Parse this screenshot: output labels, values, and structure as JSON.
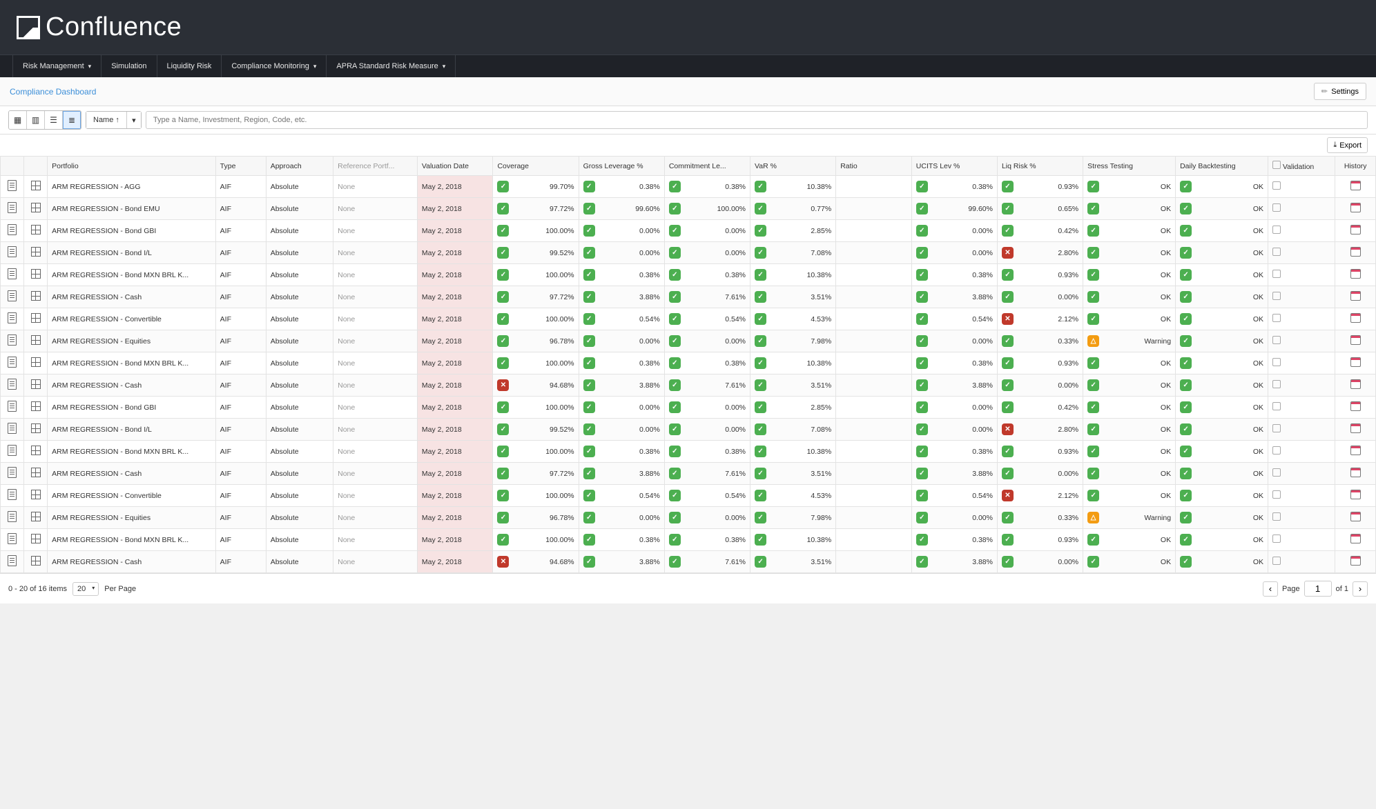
{
  "brand": "Confluence",
  "nav": [
    {
      "label": "Risk Management",
      "chevron": true
    },
    {
      "label": "Simulation",
      "chevron": false
    },
    {
      "label": "Liquidity Risk",
      "chevron": false
    },
    {
      "label": "Compliance Monitoring",
      "chevron": true
    },
    {
      "label": "APRA Standard Risk Measure",
      "chevron": true
    }
  ],
  "breadcrumb": "Compliance Dashboard",
  "settings_label": "Settings",
  "sort_label": "Name ↑",
  "search_placeholder": "Type a Name, Investment, Region, Code, etc.",
  "export_label": "Export",
  "columns": [
    "",
    "",
    "Portfolio",
    "Type",
    "Approach",
    "Reference Portf...",
    "Valuation Date",
    "Coverage",
    "Gross Leverage %",
    "Commitment Le...",
    "VaR %",
    "Ratio",
    "UCITS Lev %",
    "Liq Risk %",
    "Stress Testing",
    "Daily Backtesting",
    "Validation",
    "History"
  ],
  "rows": [
    {
      "portfolio": "ARM REGRESSION - AGG",
      "type": "AIF",
      "approach": "Absolute",
      "ref": "None",
      "date": "May 2, 2018",
      "coverage": {
        "s": "ok",
        "v": "99.70%"
      },
      "gross": {
        "s": "ok",
        "v": "0.38%"
      },
      "commit": {
        "s": "ok",
        "v": "0.38%"
      },
      "var": {
        "s": "ok",
        "v": "10.38%"
      },
      "ratio": "",
      "ucits": {
        "s": "ok",
        "v": "0.38%"
      },
      "liq": {
        "s": "ok",
        "v": "0.93%"
      },
      "stress": {
        "s": "ok",
        "v": "OK"
      },
      "back": {
        "s": "ok",
        "v": "OK"
      }
    },
    {
      "portfolio": "ARM REGRESSION - Bond EMU",
      "type": "AIF",
      "approach": "Absolute",
      "ref": "None",
      "date": "May 2, 2018",
      "coverage": {
        "s": "ok",
        "v": "97.72%"
      },
      "gross": {
        "s": "ok",
        "v": "99.60%"
      },
      "commit": {
        "s": "ok",
        "v": "100.00%"
      },
      "var": {
        "s": "ok",
        "v": "0.77%"
      },
      "ratio": "",
      "ucits": {
        "s": "ok",
        "v": "99.60%"
      },
      "liq": {
        "s": "ok",
        "v": "0.65%"
      },
      "stress": {
        "s": "ok",
        "v": "OK"
      },
      "back": {
        "s": "ok",
        "v": "OK"
      }
    },
    {
      "portfolio": "ARM REGRESSION - Bond GBI",
      "type": "AIF",
      "approach": "Absolute",
      "ref": "None",
      "date": "May 2, 2018",
      "coverage": {
        "s": "ok",
        "v": "100.00%"
      },
      "gross": {
        "s": "ok",
        "v": "0.00%"
      },
      "commit": {
        "s": "ok",
        "v": "0.00%"
      },
      "var": {
        "s": "ok",
        "v": "2.85%"
      },
      "ratio": "",
      "ucits": {
        "s": "ok",
        "v": "0.00%"
      },
      "liq": {
        "s": "ok",
        "v": "0.42%"
      },
      "stress": {
        "s": "ok",
        "v": "OK"
      },
      "back": {
        "s": "ok",
        "v": "OK"
      }
    },
    {
      "portfolio": "ARM REGRESSION - Bond I/L",
      "type": "AIF",
      "approach": "Absolute",
      "ref": "None",
      "date": "May 2, 2018",
      "coverage": {
        "s": "ok",
        "v": "99.52%"
      },
      "gross": {
        "s": "ok",
        "v": "0.00%"
      },
      "commit": {
        "s": "ok",
        "v": "0.00%"
      },
      "var": {
        "s": "ok",
        "v": "7.08%"
      },
      "ratio": "",
      "ucits": {
        "s": "ok",
        "v": "0.00%"
      },
      "liq": {
        "s": "bad",
        "v": "2.80%"
      },
      "stress": {
        "s": "ok",
        "v": "OK"
      },
      "back": {
        "s": "ok",
        "v": "OK"
      }
    },
    {
      "portfolio": "ARM REGRESSION - Bond MXN BRL K...",
      "type": "AIF",
      "approach": "Absolute",
      "ref": "None",
      "date": "May 2, 2018",
      "coverage": {
        "s": "ok",
        "v": "100.00%"
      },
      "gross": {
        "s": "ok",
        "v": "0.38%"
      },
      "commit": {
        "s": "ok",
        "v": "0.38%"
      },
      "var": {
        "s": "ok",
        "v": "10.38%"
      },
      "ratio": "",
      "ucits": {
        "s": "ok",
        "v": "0.38%"
      },
      "liq": {
        "s": "ok",
        "v": "0.93%"
      },
      "stress": {
        "s": "ok",
        "v": "OK"
      },
      "back": {
        "s": "ok",
        "v": "OK"
      }
    },
    {
      "portfolio": "ARM REGRESSION - Cash",
      "type": "AIF",
      "approach": "Absolute",
      "ref": "None",
      "date": "May 2, 2018",
      "coverage": {
        "s": "ok",
        "v": "97.72%"
      },
      "gross": {
        "s": "ok",
        "v": "3.88%"
      },
      "commit": {
        "s": "ok",
        "v": "7.61%"
      },
      "var": {
        "s": "ok",
        "v": "3.51%"
      },
      "ratio": "",
      "ucits": {
        "s": "ok",
        "v": "3.88%"
      },
      "liq": {
        "s": "ok",
        "v": "0.00%"
      },
      "stress": {
        "s": "ok",
        "v": "OK"
      },
      "back": {
        "s": "ok",
        "v": "OK"
      }
    },
    {
      "portfolio": "ARM REGRESSION - Convertible",
      "type": "AIF",
      "approach": "Absolute",
      "ref": "None",
      "date": "May 2, 2018",
      "coverage": {
        "s": "ok",
        "v": "100.00%"
      },
      "gross": {
        "s": "ok",
        "v": "0.54%"
      },
      "commit": {
        "s": "ok",
        "v": "0.54%"
      },
      "var": {
        "s": "ok",
        "v": "4.53%"
      },
      "ratio": "",
      "ucits": {
        "s": "ok",
        "v": "0.54%"
      },
      "liq": {
        "s": "bad",
        "v": "2.12%"
      },
      "stress": {
        "s": "ok",
        "v": "OK"
      },
      "back": {
        "s": "ok",
        "v": "OK"
      }
    },
    {
      "portfolio": "ARM REGRESSION - Equities",
      "type": "AIF",
      "approach": "Absolute",
      "ref": "None",
      "date": "May 2, 2018",
      "coverage": {
        "s": "ok",
        "v": "96.78%"
      },
      "gross": {
        "s": "ok",
        "v": "0.00%"
      },
      "commit": {
        "s": "ok",
        "v": "0.00%"
      },
      "var": {
        "s": "ok",
        "v": "7.98%"
      },
      "ratio": "",
      "ucits": {
        "s": "ok",
        "v": "0.00%"
      },
      "liq": {
        "s": "ok",
        "v": "0.33%"
      },
      "stress": {
        "s": "warn",
        "v": "Warning"
      },
      "back": {
        "s": "ok",
        "v": "OK"
      }
    },
    {
      "portfolio": "ARM REGRESSION - Bond MXN BRL K...",
      "type": "AIF",
      "approach": "Absolute",
      "ref": "None",
      "date": "May 2, 2018",
      "coverage": {
        "s": "ok",
        "v": "100.00%"
      },
      "gross": {
        "s": "ok",
        "v": "0.38%"
      },
      "commit": {
        "s": "ok",
        "v": "0.38%"
      },
      "var": {
        "s": "ok",
        "v": "10.38%"
      },
      "ratio": "",
      "ucits": {
        "s": "ok",
        "v": "0.38%"
      },
      "liq": {
        "s": "ok",
        "v": "0.93%"
      },
      "stress": {
        "s": "ok",
        "v": "OK"
      },
      "back": {
        "s": "ok",
        "v": "OK"
      }
    },
    {
      "portfolio": "ARM REGRESSION - Cash",
      "type": "AIF",
      "approach": "Absolute",
      "ref": "None",
      "date": "May 2, 2018",
      "coverage": {
        "s": "bad",
        "v": "94.68%"
      },
      "gross": {
        "s": "ok",
        "v": "3.88%"
      },
      "commit": {
        "s": "ok",
        "v": "7.61%"
      },
      "var": {
        "s": "ok",
        "v": "3.51%"
      },
      "ratio": "",
      "ucits": {
        "s": "ok",
        "v": "3.88%"
      },
      "liq": {
        "s": "ok",
        "v": "0.00%"
      },
      "stress": {
        "s": "ok",
        "v": "OK"
      },
      "back": {
        "s": "ok",
        "v": "OK"
      }
    },
    {
      "portfolio": "ARM REGRESSION - Bond GBI",
      "type": "AIF",
      "approach": "Absolute",
      "ref": "None",
      "date": "May 2, 2018",
      "coverage": {
        "s": "ok",
        "v": "100.00%"
      },
      "gross": {
        "s": "ok",
        "v": "0.00%"
      },
      "commit": {
        "s": "ok",
        "v": "0.00%"
      },
      "var": {
        "s": "ok",
        "v": "2.85%"
      },
      "ratio": "",
      "ucits": {
        "s": "ok",
        "v": "0.00%"
      },
      "liq": {
        "s": "ok",
        "v": "0.42%"
      },
      "stress": {
        "s": "ok",
        "v": "OK"
      },
      "back": {
        "s": "ok",
        "v": "OK"
      }
    },
    {
      "portfolio": "ARM REGRESSION - Bond I/L",
      "type": "AIF",
      "approach": "Absolute",
      "ref": "None",
      "date": "May 2, 2018",
      "coverage": {
        "s": "ok",
        "v": "99.52%"
      },
      "gross": {
        "s": "ok",
        "v": "0.00%"
      },
      "commit": {
        "s": "ok",
        "v": "0.00%"
      },
      "var": {
        "s": "ok",
        "v": "7.08%"
      },
      "ratio": "",
      "ucits": {
        "s": "ok",
        "v": "0.00%"
      },
      "liq": {
        "s": "bad",
        "v": "2.80%"
      },
      "stress": {
        "s": "ok",
        "v": "OK"
      },
      "back": {
        "s": "ok",
        "v": "OK"
      }
    },
    {
      "portfolio": "ARM REGRESSION - Bond MXN BRL K...",
      "type": "AIF",
      "approach": "Absolute",
      "ref": "None",
      "date": "May 2, 2018",
      "coverage": {
        "s": "ok",
        "v": "100.00%"
      },
      "gross": {
        "s": "ok",
        "v": "0.38%"
      },
      "commit": {
        "s": "ok",
        "v": "0.38%"
      },
      "var": {
        "s": "ok",
        "v": "10.38%"
      },
      "ratio": "",
      "ucits": {
        "s": "ok",
        "v": "0.38%"
      },
      "liq": {
        "s": "ok",
        "v": "0.93%"
      },
      "stress": {
        "s": "ok",
        "v": "OK"
      },
      "back": {
        "s": "ok",
        "v": "OK"
      }
    },
    {
      "portfolio": "ARM REGRESSION - Cash",
      "type": "AIF",
      "approach": "Absolute",
      "ref": "None",
      "date": "May 2, 2018",
      "coverage": {
        "s": "ok",
        "v": "97.72%"
      },
      "gross": {
        "s": "ok",
        "v": "3.88%"
      },
      "commit": {
        "s": "ok",
        "v": "7.61%"
      },
      "var": {
        "s": "ok",
        "v": "3.51%"
      },
      "ratio": "",
      "ucits": {
        "s": "ok",
        "v": "3.88%"
      },
      "liq": {
        "s": "ok",
        "v": "0.00%"
      },
      "stress": {
        "s": "ok",
        "v": "OK"
      },
      "back": {
        "s": "ok",
        "v": "OK"
      }
    },
    {
      "portfolio": "ARM REGRESSION - Convertible",
      "type": "AIF",
      "approach": "Absolute",
      "ref": "None",
      "date": "May 2, 2018",
      "coverage": {
        "s": "ok",
        "v": "100.00%"
      },
      "gross": {
        "s": "ok",
        "v": "0.54%"
      },
      "commit": {
        "s": "ok",
        "v": "0.54%"
      },
      "var": {
        "s": "ok",
        "v": "4.53%"
      },
      "ratio": "",
      "ucits": {
        "s": "ok",
        "v": "0.54%"
      },
      "liq": {
        "s": "bad",
        "v": "2.12%"
      },
      "stress": {
        "s": "ok",
        "v": "OK"
      },
      "back": {
        "s": "ok",
        "v": "OK"
      }
    },
    {
      "portfolio": "ARM REGRESSION - Equities",
      "type": "AIF",
      "approach": "Absolute",
      "ref": "None",
      "date": "May 2, 2018",
      "coverage": {
        "s": "ok",
        "v": "96.78%"
      },
      "gross": {
        "s": "ok",
        "v": "0.00%"
      },
      "commit": {
        "s": "ok",
        "v": "0.00%"
      },
      "var": {
        "s": "ok",
        "v": "7.98%"
      },
      "ratio": "",
      "ucits": {
        "s": "ok",
        "v": "0.00%"
      },
      "liq": {
        "s": "ok",
        "v": "0.33%"
      },
      "stress": {
        "s": "warn",
        "v": "Warning"
      },
      "back": {
        "s": "ok",
        "v": "OK"
      }
    },
    {
      "portfolio": "ARM REGRESSION - Bond MXN BRL K...",
      "type": "AIF",
      "approach": "Absolute",
      "ref": "None",
      "date": "May 2, 2018",
      "coverage": {
        "s": "ok",
        "v": "100.00%"
      },
      "gross": {
        "s": "ok",
        "v": "0.38%"
      },
      "commit": {
        "s": "ok",
        "v": "0.38%"
      },
      "var": {
        "s": "ok",
        "v": "10.38%"
      },
      "ratio": "",
      "ucits": {
        "s": "ok",
        "v": "0.38%"
      },
      "liq": {
        "s": "ok",
        "v": "0.93%"
      },
      "stress": {
        "s": "ok",
        "v": "OK"
      },
      "back": {
        "s": "ok",
        "v": "OK"
      }
    },
    {
      "portfolio": "ARM REGRESSION - Cash",
      "type": "AIF",
      "approach": "Absolute",
      "ref": "None",
      "date": "May 2, 2018",
      "coverage": {
        "s": "bad",
        "v": "94.68%"
      },
      "gross": {
        "s": "ok",
        "v": "3.88%"
      },
      "commit": {
        "s": "ok",
        "v": "7.61%"
      },
      "var": {
        "s": "ok",
        "v": "3.51%"
      },
      "ratio": "",
      "ucits": {
        "s": "ok",
        "v": "3.88%"
      },
      "liq": {
        "s": "ok",
        "v": "0.00%"
      },
      "stress": {
        "s": "ok",
        "v": "OK"
      },
      "back": {
        "s": "ok",
        "v": "OK"
      }
    }
  ],
  "pager": {
    "summary": "0 - 20 of 16 items",
    "per_page_value": "20",
    "per_page_label": "Per Page",
    "page_label": "Page",
    "page_value": "1",
    "of_label": "of 1"
  }
}
